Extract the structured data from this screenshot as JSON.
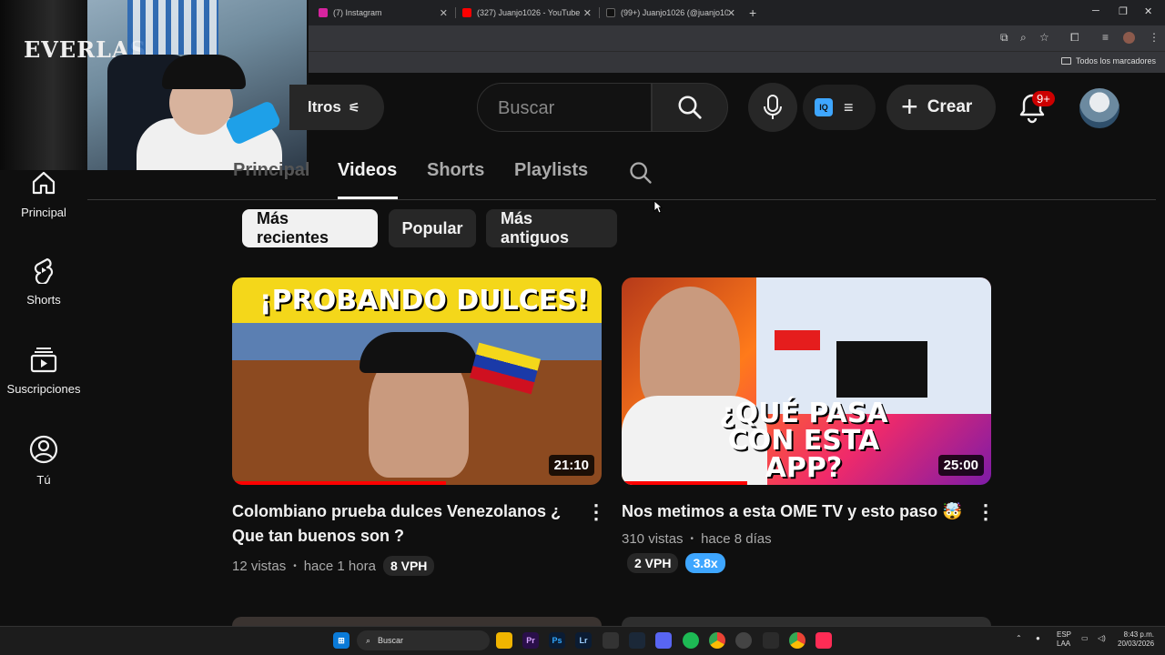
{
  "browser": {
    "tabs": [
      {
        "label": "(7) Instagram",
        "color": "#d6249f"
      },
      {
        "label": "(327) Juanjo1026 - YouTube",
        "color": "#ff0000"
      },
      {
        "label": "(99+) Juanjo1026 (@juanjo1026",
        "color": "#111111"
      }
    ],
    "bookmarks_label": "Todos los marcadores"
  },
  "webcam": {
    "overlay_text": "EVERLAS"
  },
  "header": {
    "filter_label": "ltros",
    "search_placeholder": "Buscar",
    "iq_label": "IQ",
    "create_label": "Crear",
    "notifications_badge": "9+"
  },
  "sidebar": {
    "items": [
      {
        "label": "Principal",
        "icon": "home-icon"
      },
      {
        "label": "Shorts",
        "icon": "shorts-icon"
      },
      {
        "label": "Suscripciones",
        "icon": "subscriptions-icon"
      },
      {
        "label": "Tú",
        "icon": "user-icon"
      }
    ]
  },
  "channel_tabs": {
    "items": [
      "Principal",
      "Videos",
      "Shorts",
      "Playlists"
    ],
    "active": "Videos"
  },
  "chips": [
    "Más recientes",
    "Popular",
    "Más antiguos"
  ],
  "videos": [
    {
      "thumb_text": "¡PROBANDO DULCES!",
      "duration": "21:10",
      "title_line1": "Colombiano prueba dulces Venezolanos ¿",
      "title_line2": "Que tan buenos son ?",
      "views": "12 vistas",
      "age": "hace 1 hora",
      "vph": "8 VPH",
      "watched": 0.58
    },
    {
      "thumb_text": "¿QUÉ PASA CON ESTA APP?",
      "duration": "25:00",
      "title_line1": "Nos metimos a esta OME TV y esto paso 🤯",
      "views": "310 vistas",
      "age": "hace 8 días",
      "vph": "2 VPH",
      "multiplier": "3.8x",
      "watched": 0.34
    }
  ],
  "taskbar": {
    "search_label": "Buscar",
    "lang_line1": "ESP",
    "lang_line2": "LAA",
    "time": "8:43 p.m.",
    "date": "20/03/2026"
  }
}
